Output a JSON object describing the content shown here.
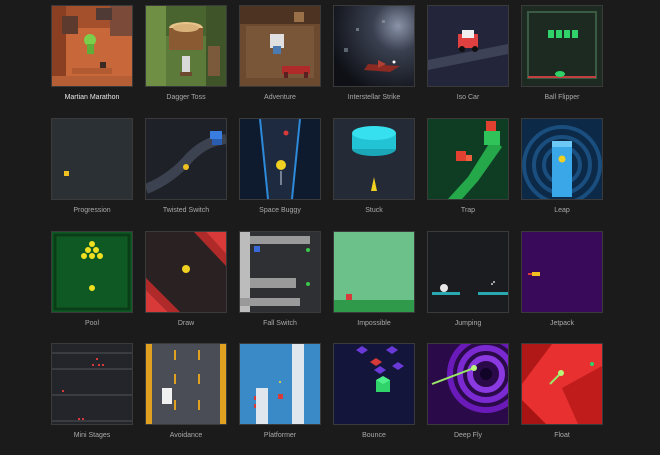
{
  "games": [
    {
      "key": "martian-marathon",
      "title": "Martian Marathon",
      "selected": true
    },
    {
      "key": "dagger-toss",
      "title": "Dagger Toss"
    },
    {
      "key": "adventure",
      "title": "Adventure"
    },
    {
      "key": "interstellar-strike",
      "title": "Interstellar Strike"
    },
    {
      "key": "iso-car",
      "title": "Iso Car"
    },
    {
      "key": "ball-flipper",
      "title": "Ball Flipper"
    },
    {
      "key": "progression",
      "title": "Progression"
    },
    {
      "key": "twisted-switch",
      "title": "Twisted Switch"
    },
    {
      "key": "space-buggy",
      "title": "Space Buggy"
    },
    {
      "key": "stuck",
      "title": "Stuck"
    },
    {
      "key": "trap",
      "title": "Trap"
    },
    {
      "key": "leap",
      "title": "Leap"
    },
    {
      "key": "pool",
      "title": "Pool"
    },
    {
      "key": "draw",
      "title": "Draw"
    },
    {
      "key": "fall-switch",
      "title": "Fall Switch"
    },
    {
      "key": "impossible",
      "title": "Impossible"
    },
    {
      "key": "jumping",
      "title": "Jumping"
    },
    {
      "key": "jetpack",
      "title": "Jetpack"
    },
    {
      "key": "mini-stages",
      "title": "Mini Stages"
    },
    {
      "key": "avoidance",
      "title": "Avoidance"
    },
    {
      "key": "platformer",
      "title": "Platformer"
    },
    {
      "key": "bounce",
      "title": "Bounce"
    },
    {
      "key": "deep-fly",
      "title": "Deep Fly"
    },
    {
      "key": "float",
      "title": "Float"
    }
  ],
  "colors": {
    "background": "#1b1b1b",
    "label": "#a9a9a9",
    "label_selected": "#e6e6e6",
    "tile_border": "#3a3a3a"
  }
}
